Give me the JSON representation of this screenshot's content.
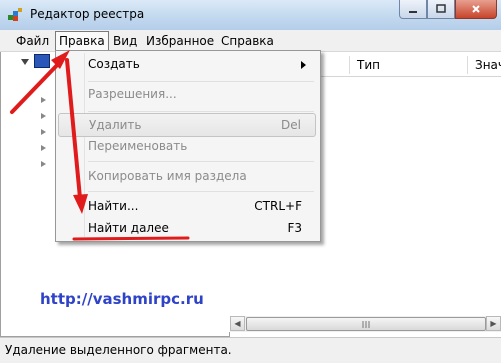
{
  "window": {
    "title": "Редактор реестра",
    "icon": "registry-editor-icon",
    "controls": [
      "minimize",
      "maximize",
      "close"
    ]
  },
  "menubar": {
    "items": [
      {
        "label": "Файл"
      },
      {
        "label": "Правка"
      },
      {
        "label": "Вид"
      },
      {
        "label": "Избранное"
      },
      {
        "label": "Справка"
      }
    ],
    "active": "Правка"
  },
  "list_columns": [
    "Тип",
    "Знач"
  ],
  "edit_menu": {
    "items": [
      {
        "label": "Создать",
        "submenu": true,
        "enabled": true
      },
      {
        "label": "Разрешения...",
        "enabled": false
      },
      {
        "label": "Удалить",
        "shortcut": "Del",
        "enabled": false
      },
      {
        "label": "Переименовать",
        "enabled": false
      },
      {
        "label": "Копировать имя раздела",
        "enabled": false
      },
      {
        "label": "Найти...",
        "shortcut": "CTRL+F",
        "enabled": true
      },
      {
        "label": "Найти далее",
        "shortcut": "F3",
        "enabled": true
      }
    ]
  },
  "status": {
    "text": "Удаление выделенного фрагмента."
  },
  "watermark": {
    "text": "http://vashmirpc.ru"
  },
  "colors": {
    "annotation": "#e01b1b",
    "watermark": "#2f43c8",
    "titlebar": "#c3d9ef"
  }
}
